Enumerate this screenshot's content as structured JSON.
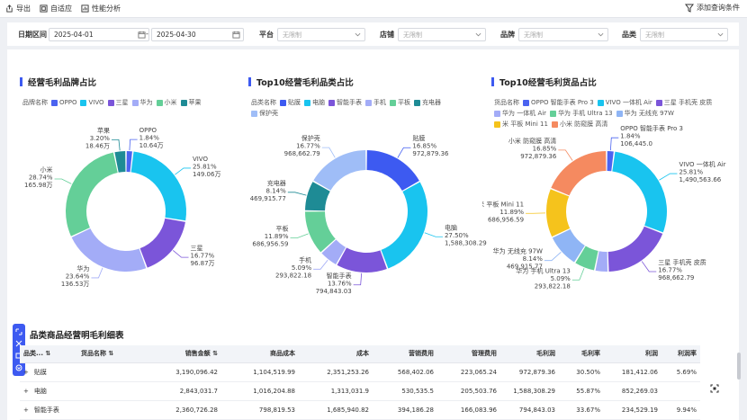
{
  "toolbar": {
    "export_label": "导出",
    "adapt_label": "自适应",
    "perf_label": "性能分析",
    "add_query_label": "添加查询条件"
  },
  "filters": {
    "date_label": "日期区间",
    "date_start": "2025-04-01",
    "date_sep": "-",
    "date_end": "2025-04-30",
    "platform_label": "平台",
    "platform_value": "无限制",
    "shop_label": "店铺",
    "shop_value": "无限制",
    "brand_label": "品牌",
    "brand_value": "无限制",
    "category_label": "品类",
    "category_value": "无限制"
  },
  "colors": {
    "accent": "#3d5af1"
  },
  "chart_data": [
    {
      "type": "pie",
      "title": "经营毛利品牌占比",
      "legend_title": "品牌名称",
      "categories": [
        "OPPO",
        "VIVO",
        "三星",
        "华为",
        "小米",
        "苹果"
      ],
      "values": [
        1.84,
        25.81,
        16.77,
        23.64,
        28.74,
        3.2
      ],
      "percent_labels": [
        "1.84%",
        "25.81%",
        "16.77%",
        "23.64%",
        "28.74%",
        "3.20%"
      ],
      "value_labels": [
        "10.64万",
        "149.06万",
        "96.87万",
        "136.53万",
        "165.98万",
        "18.46万"
      ],
      "colors": [
        "#4b63f0",
        "#19c4ef",
        "#7b55d9",
        "#a3acf7",
        "#64cf98",
        "#1e8b95"
      ]
    },
    {
      "type": "pie",
      "title": "Top10经营毛利品类占比",
      "legend_title": "品类名称",
      "categories": [
        "贴膜",
        "电脑",
        "智能手表",
        "手机",
        "平板",
        "充电器",
        "保护壳"
      ],
      "values": [
        16.85,
        27.5,
        13.76,
        5.09,
        11.89,
        8.14,
        16.77
      ],
      "percent_labels": [
        "16.85%",
        "27.50%",
        "13.76%",
        "5.09%",
        "11.89%",
        "8.14%",
        "16.77%"
      ],
      "value_labels": [
        "972,879.36",
        "1,588,308.29",
        "794,843.03",
        "293,822.18",
        "686,956.59",
        "469,915.77",
        "968,662.79"
      ],
      "colors": [
        "#3d5af1",
        "#19c4ef",
        "#7b55d9",
        "#a3acf7",
        "#64cf98",
        "#1e8b95",
        "#9fbdf7"
      ]
    },
    {
      "type": "pie",
      "title": "Top10经营毛利货品占比",
      "legend_title": "货品名称",
      "categories": [
        "OPPO 智能手表 Pro 3",
        "VIVO 一体机 Air",
        "三星 手机壳 皮质",
        "华为 一体机 Air",
        "华为 手机 Ultra 13",
        "华为 无线充 97W",
        "米 平板 Mini 11",
        "小米 防窥膜 高清"
      ],
      "values": [
        1.84,
        25.81,
        16.77,
        3.2,
        5.09,
        8.14,
        11.89,
        16.85
      ],
      "percent_labels": [
        "1.84%",
        "25.81%",
        "16.77%",
        "",
        "5.09%",
        "8.14%",
        "11.89%",
        "16.85%"
      ],
      "value_labels": [
        "106,445.0",
        "1,490,563.66",
        "968,662.79",
        "",
        "293,822.18",
        "469,915.77",
        "686,956.59",
        "972,879.36"
      ],
      "colors": [
        "#4b63f0",
        "#19c4ef",
        "#7b55d9",
        "#a3acf7",
        "#64cf98",
        "#8fb5f5",
        "#f5c31c",
        "#f58a60"
      ]
    }
  ],
  "table": {
    "title": "品类商品经营明毛利细表",
    "headers": [
      "品类...",
      "货品名称",
      "销售金额",
      "商品成本",
      "成本",
      "营销费用",
      "管理费用",
      "毛利润",
      "毛利率",
      "利润",
      "利润率"
    ],
    "rows": [
      {
        "cat": "贴膜",
        "cells": [
          "3,190,096.42",
          "1,104,519.99",
          "2,351,253.26",
          "568,402.06",
          "223,065.24",
          "972,879.36",
          "30.50%",
          "181,412.06",
          "5.69%"
        ]
      },
      {
        "cat": "电脑",
        "cells": [
          "2,843,031.7",
          "1,016,204.88",
          "1,313,031.9",
          "530,535.5",
          "205,503.76",
          "1,588,308.29",
          "55.87%",
          "852,269.03",
          ""
        ]
      },
      {
        "cat": "智能手表",
        "cells": [
          "2,360,726.28",
          "798,819.53",
          "1,685,940.82",
          "394,186.28",
          "166,083.96",
          "794,843.03",
          "33.67%",
          "234,529.19",
          "9.94%"
        ]
      }
    ]
  }
}
